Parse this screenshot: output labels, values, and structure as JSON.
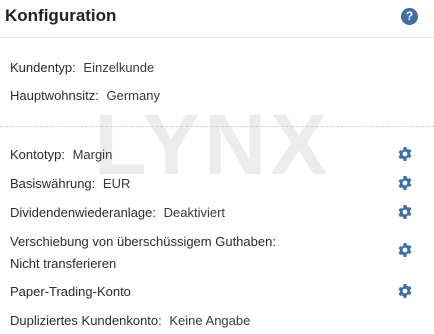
{
  "header": {
    "title": "Konfiguration",
    "help_icon": "question-circle-icon"
  },
  "watermark": "LYNX",
  "account_info": {
    "customer_type": {
      "label": "Kundentyp:",
      "value": "Einzelkunde"
    },
    "residence": {
      "label": "Hauptwohnsitz:",
      "value": "Germany"
    }
  },
  "settings": {
    "account_type": {
      "label": "Kontotyp:",
      "value": "Margin"
    },
    "base_currency": {
      "label": "Basiswährung:",
      "value": "EUR"
    },
    "dividend_reinvest": {
      "label": "Dividendenwiederanlage:",
      "value": "Deaktiviert"
    },
    "excess_transfer": {
      "label": "Verschiebung von überschüssigem Guthaben:",
      "value": "Nicht transferieren"
    },
    "paper_trading": {
      "label": "Paper-Trading-Konto"
    },
    "duplicate_account": {
      "label": "Dupliziertes Kundenkonto:",
      "value": "Keine Angabe"
    }
  },
  "colors": {
    "gear": "#3f6fa6",
    "help": "#3f6fa6",
    "watermark": "#ececec"
  }
}
